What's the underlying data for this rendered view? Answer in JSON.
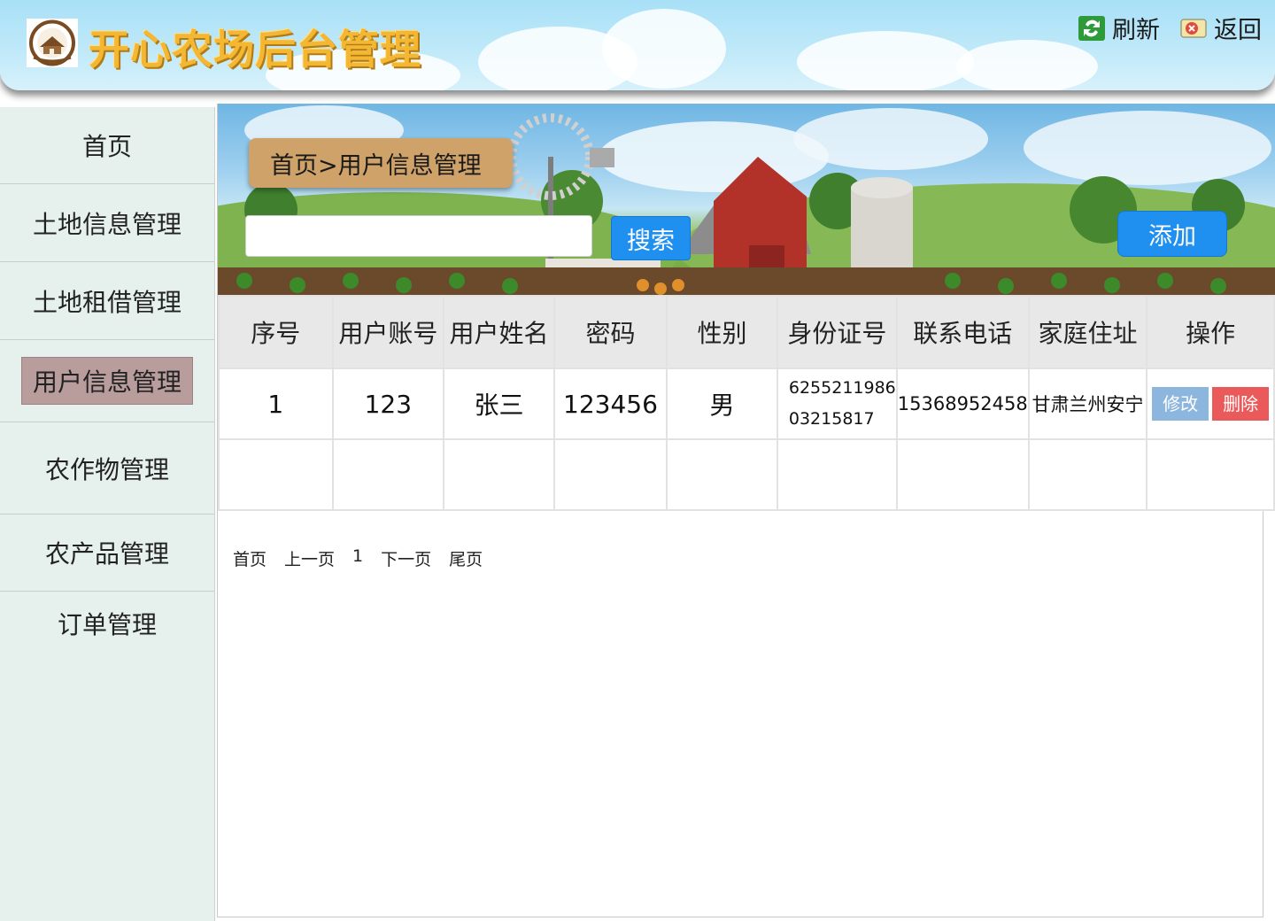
{
  "header": {
    "title": "开心农场后台管理",
    "refresh_label": "刷新",
    "back_label": "返回"
  },
  "sidebar": {
    "items": [
      {
        "label": "首页"
      },
      {
        "label": "土地信息管理"
      },
      {
        "label": "土地租借管理"
      },
      {
        "label": "用户信息管理",
        "active": true
      },
      {
        "label": "农作物管理"
      },
      {
        "label": "农产品管理"
      },
      {
        "label": "订单管理"
      }
    ]
  },
  "breadcrumb": "首页>用户信息管理",
  "search": {
    "value": "",
    "button_label": "搜索"
  },
  "add_label": "添加",
  "table": {
    "headers": [
      "序号",
      "用户账号",
      "用户姓名",
      "密码",
      "性别",
      "身份证号",
      "联系电话",
      "家庭住址",
      "操作"
    ],
    "rows": [
      {
        "index": "1",
        "account": "123",
        "name": "张三",
        "password": "123456",
        "gender": "男",
        "id_card": "625521198603215817",
        "id_card_line1": "6255211986",
        "id_card_line2": "03215817",
        "phone": "15368952458",
        "address": "甘肃兰州安宁",
        "edit_label": "修改",
        "delete_label": "删除"
      }
    ]
  },
  "pagination": {
    "first": "首页",
    "prev": "上一页",
    "current": "1",
    "next": "下一页",
    "last": "尾页"
  },
  "colors": {
    "accent_blue": "#1f8ff0",
    "breadcrumb_bg": "#cfa26a",
    "sidebar_bg": "#e6f1ee",
    "active_item_bg": "#b99d9d",
    "edit_btn": "#8db6de",
    "delete_btn": "#ea5a5a",
    "title_gold": "#f3b733"
  }
}
